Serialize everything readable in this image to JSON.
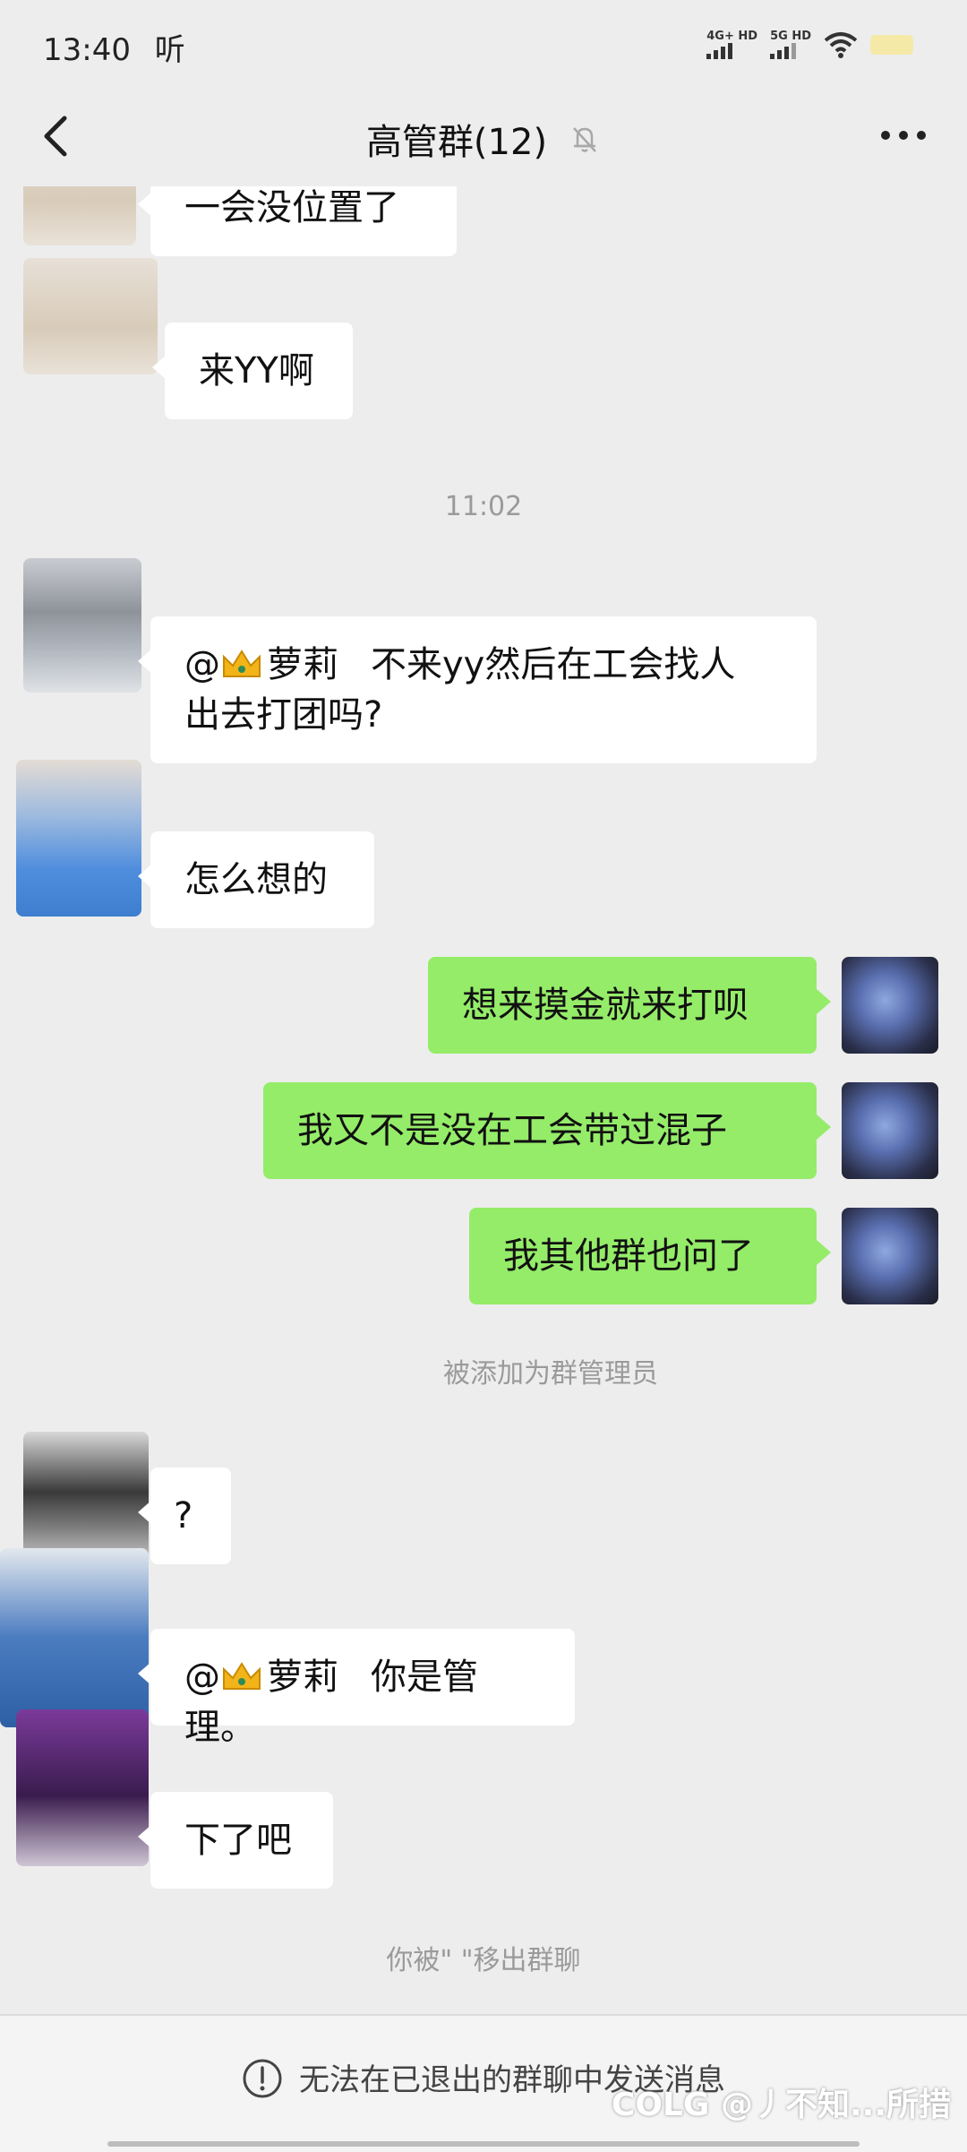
{
  "status_bar": {
    "time": "13:40",
    "extra": "听",
    "signal1_label": "4G+ HD",
    "signal2_label": "5G HD"
  },
  "header": {
    "title": "高管群(12)",
    "back_icon": "chevron-left-icon",
    "mute_icon": "bell-off-icon",
    "more_icon": "more-dots-icon"
  },
  "messages": [
    {
      "side": "left",
      "text": "一会没位置了"
    },
    {
      "side": "left",
      "text": "来YY啊"
    },
    {
      "type": "time",
      "text": "11:02"
    },
    {
      "side": "left",
      "mention": "@",
      "mention_name": "萝莉",
      "text_line1": "不来yy然后在工会找人",
      "text_line2": "出去打团吗?"
    },
    {
      "side": "left",
      "text": "怎么想的"
    },
    {
      "side": "right",
      "text": "想来摸金就来打呗"
    },
    {
      "side": "right",
      "text": "我又不是没在工会带过混子"
    },
    {
      "side": "right",
      "text": "我其他群也问了"
    },
    {
      "type": "system",
      "text": "被添加为群管理员"
    },
    {
      "side": "left",
      "text": "?"
    },
    {
      "side": "left",
      "mention": "@",
      "mention_name": "萝莉",
      "text": "你是管理。"
    },
    {
      "side": "left",
      "text": "下了吧"
    },
    {
      "type": "system",
      "text": "你被\"  \"移出群聊"
    }
  ],
  "footer": {
    "notice": "无法在已退出的群聊中发送消息",
    "watermark": "COLG @丿不知...所措"
  },
  "colors": {
    "background": "#ededed",
    "bubble_self": "#95ec69",
    "bubble_other": "#ffffff"
  }
}
